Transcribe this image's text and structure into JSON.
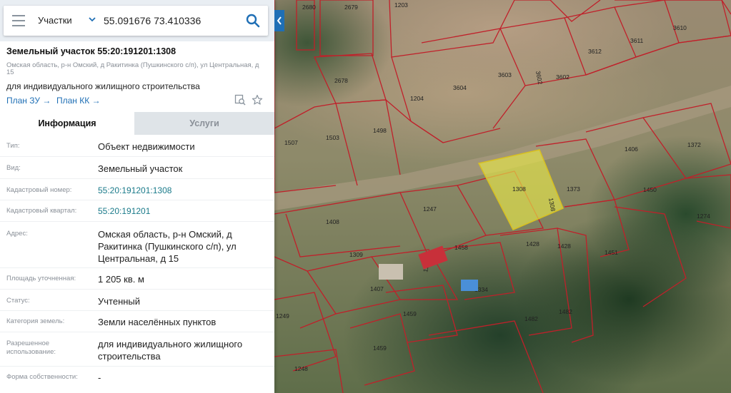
{
  "search": {
    "layer": "Участки",
    "query": "55.091676 73.410336"
  },
  "object": {
    "title": "Земельный участок 55:20:191201:1308",
    "address": "Омская область, р-н Омский, д Ракитинка (Пушкинского с/п), ул Центральная, д 15",
    "purpose": "для индивидуального жилищного строительства",
    "plan_zu": "План ЗУ →",
    "plan_kk": "План КК →"
  },
  "tabs": {
    "info": "Информация",
    "services": "Услуги"
  },
  "info": [
    {
      "label": "Тип:",
      "value": "Объект недвижимости"
    },
    {
      "label": "Вид:",
      "value": "Земельный участок"
    },
    {
      "label": "Кадастровый номер:",
      "value": "55:20:191201:1308"
    },
    {
      "label": "Кадастровый квартал:",
      "value": "55:20:191201"
    },
    {
      "label": "Адрес:",
      "value": "Омская область, р-н Омский, д Ракитинка (Пушкинского с/п), ул Центральная, д 15"
    },
    {
      "label": "Площадь уточненная:",
      "value": "1 205 кв. м"
    },
    {
      "label": "Статус:",
      "value": "Учтенный"
    },
    {
      "label": "Категория земель:",
      "value": "Земли населённых пунктов"
    },
    {
      "label": "Разрешенное использование:",
      "value": "для индивидуального жилищного строительства"
    },
    {
      "label": "Форма собственности:",
      "value": "-"
    }
  ],
  "map": {
    "parcel_labels": [
      "2680",
      "2679",
      "1203",
      "3610",
      "3611",
      "3612",
      "3603",
      "3602",
      "3602",
      "3604",
      "2678",
      "1204",
      "1507",
      "1503",
      "1498",
      "1406",
      "1372",
      "1308",
      "1308",
      "1373",
      "1450",
      "1274",
      "1408",
      "1247",
      "1309",
      "1458",
      "1428",
      "1428",
      "1451",
      "1120",
      "1407",
      "1334",
      "1459",
      "1482",
      "1482",
      "1249",
      "1459",
      "1248"
    ],
    "selected_color": "#e6e64a",
    "boundary_color": "#c0202a"
  }
}
